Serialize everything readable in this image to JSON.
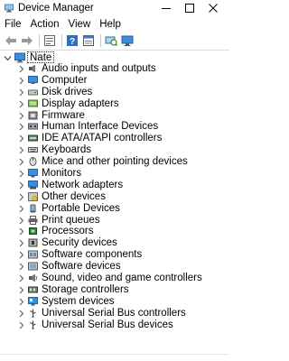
{
  "window": {
    "title": "Device Manager",
    "icons": {
      "app": "device-manager-icon",
      "minimize": "minimize-icon",
      "maximize": "maximize-icon",
      "close": "close-icon"
    }
  },
  "menu": {
    "items": [
      {
        "label": "File"
      },
      {
        "label": "Action"
      },
      {
        "label": "View"
      },
      {
        "label": "Help"
      }
    ]
  },
  "toolbar": {
    "buttons": [
      {
        "icon": "back-arrow-icon"
      },
      {
        "icon": "forward-arrow-icon"
      },
      {
        "icon": "properties-icon"
      },
      {
        "icon": "help-icon"
      },
      {
        "icon": "properties-sheet-icon"
      },
      {
        "icon": "scan-hardware-icon"
      },
      {
        "icon": "monitor-icon"
      }
    ]
  },
  "tree": {
    "root": {
      "label": "Nate",
      "icon": "computer-icon",
      "expanded": true
    },
    "devices": [
      {
        "label": "Audio inputs and outputs",
        "icon": "speaker-icon"
      },
      {
        "label": "Computer",
        "icon": "computer-icon"
      },
      {
        "label": "Disk drives",
        "icon": "disk-drive-icon"
      },
      {
        "label": "Display adapters",
        "icon": "display-adapter-icon"
      },
      {
        "label": "Firmware",
        "icon": "firmware-icon"
      },
      {
        "label": "Human Interface Devices",
        "icon": "hid-icon"
      },
      {
        "label": "IDE ATA/ATAPI controllers",
        "icon": "ide-controller-icon"
      },
      {
        "label": "Keyboards",
        "icon": "keyboard-icon"
      },
      {
        "label": "Mice and other pointing devices",
        "icon": "mouse-icon"
      },
      {
        "label": "Monitors",
        "icon": "monitor-icon"
      },
      {
        "label": "Network adapters",
        "icon": "network-adapter-icon"
      },
      {
        "label": "Other devices",
        "icon": "unknown-device-icon"
      },
      {
        "label": "Portable Devices",
        "icon": "portable-device-icon"
      },
      {
        "label": "Print queues",
        "icon": "printer-icon"
      },
      {
        "label": "Processors",
        "icon": "processor-icon"
      },
      {
        "label": "Security devices",
        "icon": "security-device-icon"
      },
      {
        "label": "Software components",
        "icon": "software-component-icon"
      },
      {
        "label": "Software devices",
        "icon": "software-device-icon"
      },
      {
        "label": "Sound, video and game controllers",
        "icon": "sound-controller-icon"
      },
      {
        "label": "Storage controllers",
        "icon": "storage-controller-icon"
      },
      {
        "label": "System devices",
        "icon": "system-device-icon"
      },
      {
        "label": "Universal Serial Bus controllers",
        "icon": "usb-icon"
      },
      {
        "label": "Universal Serial Bus devices",
        "icon": "usb-icon"
      }
    ]
  }
}
